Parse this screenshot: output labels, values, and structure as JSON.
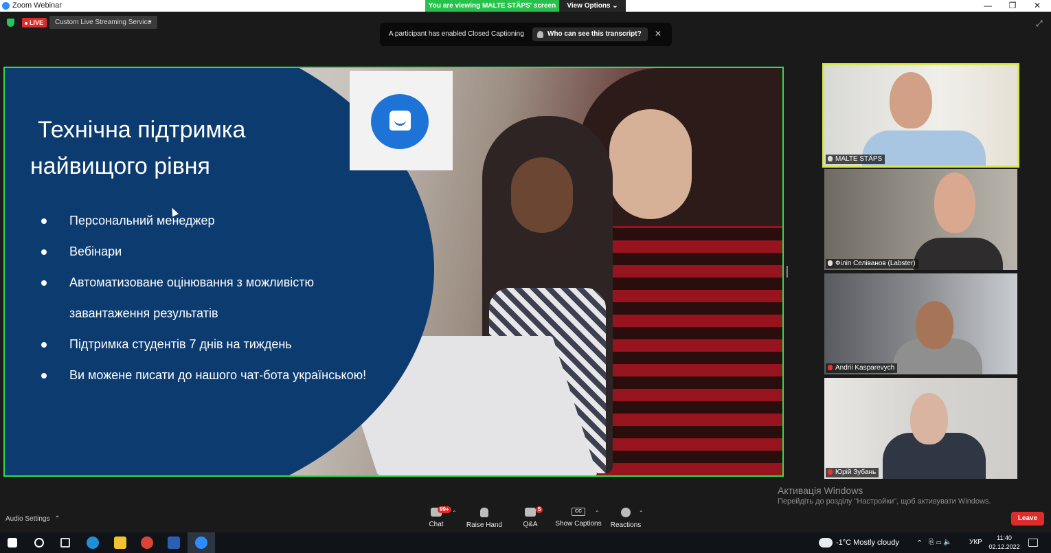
{
  "window": {
    "title": "Zoom Webinar",
    "share_banner": "You are viewing MALTE STÄPS' screen",
    "view_options": "View Options ⌄",
    "minimize": "—",
    "restore": "❐",
    "close": "✕"
  },
  "topbar": {
    "live_label": "LIVE",
    "stream_service": "Custom Live Streaming Service",
    "stream_caret": "▼"
  },
  "cc_notification": {
    "text": "A participant has enabled Closed Captioning",
    "button": "Who can see this transcript?",
    "close": "✕"
  },
  "slide": {
    "title_line1": "Технічна підтримка",
    "title_line2": "найвищого рівня",
    "bullets": [
      "Персональний менеджер",
      "Вебінари",
      "Автоматизоване оцінювання з можливістю",
      "завантаження результатів",
      "Підтримка студентів 7 днів на тиждень",
      "Ви можене писати до нашого чат-бота українською!"
    ]
  },
  "participants": [
    {
      "name": "MALTE STÄPS",
      "active": true,
      "muted": false
    },
    {
      "name": "Філіп Селіванов (Labster)",
      "active": false,
      "muted": false
    },
    {
      "name": "Andrii Kasparevych",
      "active": false,
      "muted": true
    },
    {
      "name": "Юрій Зубань",
      "active": false,
      "muted": true
    }
  ],
  "watermark": {
    "line1": "Активація Windows",
    "line2": "Перейдіть до розділу \"Настройки\", щоб активувати Windows."
  },
  "toolbar": {
    "audio_settings": "Audio Settings",
    "audio_caret": "⌃",
    "chat_label": "Chat",
    "chat_badge": "99+",
    "raise_hand_label": "Raise Hand",
    "qa_label": "Q&A",
    "qa_badge": "5",
    "captions_label": "Show Captions",
    "captions_icon_text": "CC",
    "reactions_label": "Reactions",
    "chevron": "⌃",
    "leave_label": "Leave"
  },
  "taskbar": {
    "weather": "-1°C  Mostly cloudy",
    "tray_caret": "⌃",
    "language": "УКР",
    "time": "11:40",
    "date": "02.12.2022"
  },
  "colors": {
    "share_border": "#2fdc4a",
    "active_speaker": "#d7e94d",
    "slide_blue": "#0c3b70",
    "live_red": "#e02b2b",
    "banner_green": "#27c24c"
  }
}
